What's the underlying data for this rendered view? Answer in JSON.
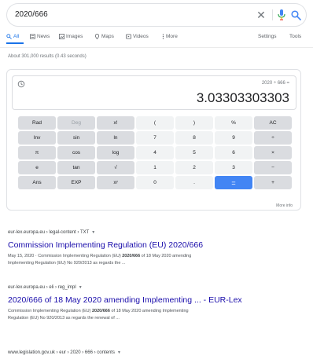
{
  "search": {
    "query": "2020/666",
    "icons": {
      "clear": "close-icon",
      "mic": "mic-icon",
      "search": "search-icon"
    }
  },
  "tabs": [
    {
      "label": "All",
      "icon": "search-icon",
      "active": true
    },
    {
      "label": "News",
      "icon": "news-icon",
      "active": false
    },
    {
      "label": "Images",
      "icon": "image-icon",
      "active": false
    },
    {
      "label": "Maps",
      "icon": "map-pin-icon",
      "active": false
    },
    {
      "label": "Videos",
      "icon": "video-icon",
      "active": false
    },
    {
      "label": "More",
      "icon": "more-icon",
      "active": false
    }
  ],
  "tools": {
    "settings": "Settings",
    "tools": "Tools"
  },
  "results_stats": "About 301,000 results (0.43 seconds)",
  "calculator": {
    "expression": "2020 ÷ 666 =",
    "result": "3.03303303303",
    "more_info": "More info",
    "keys": [
      [
        "Rad",
        "Deg",
        "x!",
        "(",
        ")",
        "%",
        "AC"
      ],
      [
        "Inv",
        "sin",
        "ln",
        "7",
        "8",
        "9",
        "÷"
      ],
      [
        "π",
        "cos",
        "log",
        "4",
        "5",
        "6",
        "×"
      ],
      [
        "e",
        "tan",
        "√",
        "1",
        "2",
        "3",
        "−"
      ],
      [
        "Ans",
        "EXP",
        "xʸ",
        "0",
        ".",
        "=",
        "+"
      ]
    ],
    "colors": {
      "dark_key": "#dadce0",
      "light_key": "#f1f3f4",
      "equals": "#4285f4"
    }
  },
  "results": [
    {
      "url": "eur-lex.europa.eu › legal-content › TXT",
      "title": "Commission Implementing Regulation (EU) 2020/666",
      "snippet_1": "May 15, 2020 · Commission Implementing Regulation (EU) ",
      "snippet_bold": "2020/666",
      "snippet_2": " of 18 May 2020 amending",
      "snippet_line2": "Implementing Regulation (EU) No 920/2013 as regards the ..."
    },
    {
      "url": "eur-lex.europa.eu › eli › reg_impl",
      "title": "2020/666 of 18 May 2020 amending Implementing ... - EUR-Lex",
      "snippet_1": "Commission Implementing Regulation (EU) ",
      "snippet_bold": "2020/666",
      "snippet_2": " of 18 May 2020 amending Implementing",
      "snippet_line2": "Regulation (EU) No 920/2013 as regards the renewal of ..."
    },
    {
      "url": "www.legislation.gov.uk › eur › 2020 › 666 › contents"
    }
  ]
}
